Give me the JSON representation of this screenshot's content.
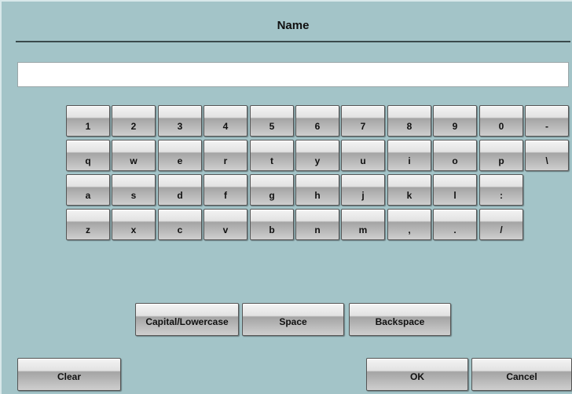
{
  "dialog": {
    "title": "Name",
    "input_value": ""
  },
  "keyboard": {
    "rows": [
      [
        "1",
        "2",
        "3",
        "4",
        "5",
        "6",
        "7",
        "8",
        "9",
        "0",
        "-"
      ],
      [
        "q",
        "w",
        "e",
        "r",
        "t",
        "y",
        "u",
        "i",
        "o",
        "p",
        "\\"
      ],
      [
        "a",
        "s",
        "d",
        "f",
        "g",
        "h",
        "j",
        "k",
        "l",
        ":"
      ],
      [
        "z",
        "x",
        "c",
        "v",
        "b",
        "n",
        "m",
        ",",
        ".",
        "/"
      ]
    ]
  },
  "controls": {
    "case_label": "Capital/Lowercase",
    "space_label": "Space",
    "backspace_label": "Backspace",
    "clear_label": "Clear",
    "ok_label": "OK",
    "cancel_label": "Cancel"
  },
  "colors": {
    "background": "#a3c4c8",
    "key_face": "#e2e2e2",
    "title_rule": "#3a4a4c"
  }
}
